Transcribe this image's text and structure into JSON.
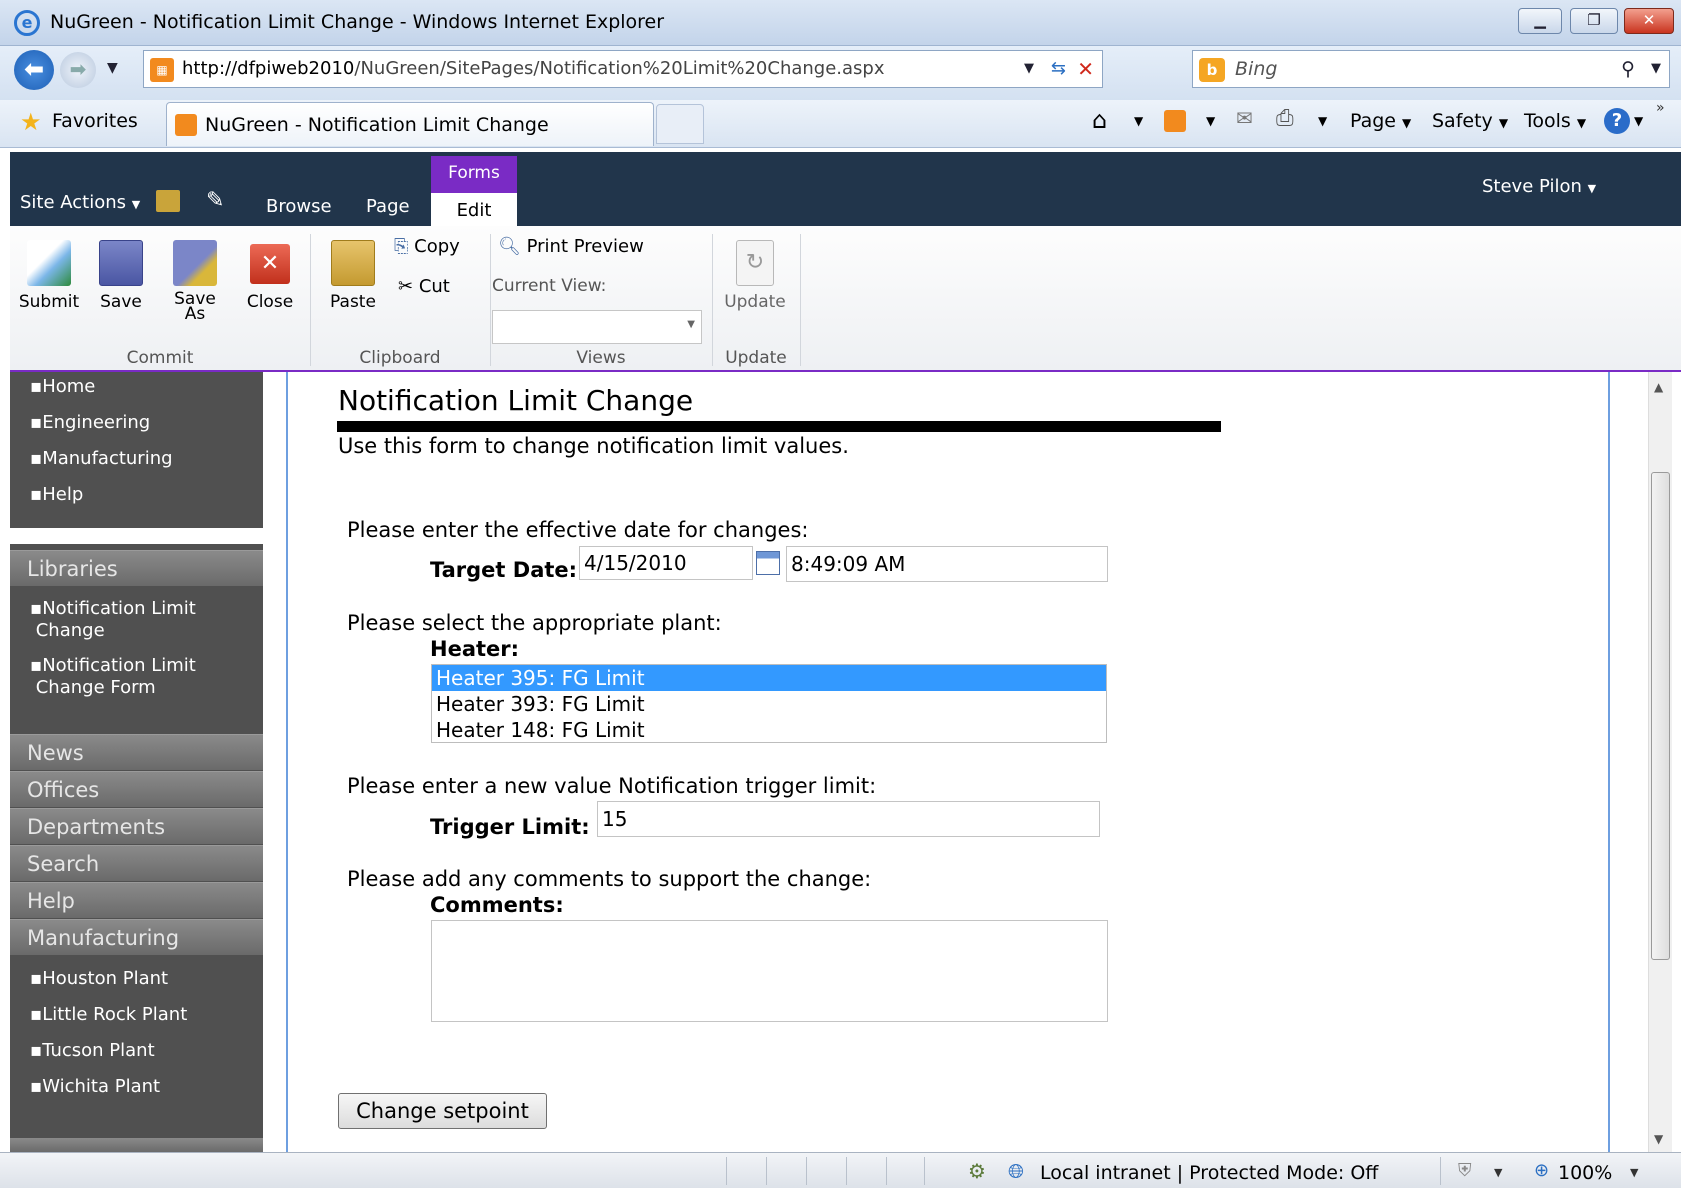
{
  "browser": {
    "window_title": "NuGreen - Notification Limit Change - Windows Internet Explorer",
    "url_host": "http://dfpiweb2010",
    "url_path": "/NuGreen/SitePages/Notification%20Limit%20Change.aspx",
    "search_placeholder": "Bing",
    "favorites_label": "Favorites",
    "tab_label": "NuGreen - Notification Limit Change",
    "menu": {
      "page": "Page",
      "safety": "Safety",
      "tools": "Tools"
    }
  },
  "sharepoint": {
    "site_actions": "Site Actions",
    "tabs": {
      "browse": "Browse",
      "page": "Page",
      "edit": "Edit"
    },
    "context_tab": "Forms",
    "user": "Steve Pilon",
    "ribbon": {
      "submit": "Submit",
      "save": "Save",
      "save_as_1": "Save",
      "save_as_2": "As",
      "close": "Close",
      "paste": "Paste",
      "copy": "Copy",
      "cut": "Cut",
      "print_preview": "Print Preview",
      "current_view": "Current View:",
      "update": "Update",
      "groups": {
        "commit": "Commit",
        "clipboard": "Clipboard",
        "views": "Views",
        "update": "Update"
      }
    }
  },
  "leftnav": {
    "top_links": [
      "Home",
      "Engineering",
      "Manufacturing",
      "Help"
    ],
    "libraries_heading": "Libraries",
    "library_links": [
      {
        "line1": "Notification Limit",
        "line2": "Change"
      },
      {
        "line1": "Notification Limit",
        "line2": "Change Form"
      }
    ],
    "headings": [
      "News",
      "Offices",
      "Departments",
      "Search",
      "Help",
      "Manufacturing"
    ],
    "plant_links": [
      "Houston Plant",
      "Little Rock Plant",
      "Tucson Plant",
      "Wichita Plant"
    ]
  },
  "form": {
    "title": "Notification Limit Change",
    "description": "Use this form to change notification limit values.",
    "date_prompt": "Please enter the effective date for changes:",
    "target_date_label": "Target Date:",
    "target_date_value": "4/15/2010",
    "target_time_value": "8:49:09 AM",
    "plant_prompt": "Please select the appropriate plant:",
    "heater_label": "Heater:",
    "heater_options": [
      "Heater 395: FG Limit",
      "Heater 393: FG Limit",
      "Heater 148: FG Limit"
    ],
    "heater_selected": "Heater 395: FG Limit",
    "trigger_prompt": "Please enter a new value Notification trigger limit:",
    "trigger_label": "Trigger Limit:",
    "trigger_value": "15",
    "comments_prompt": "Please add any comments to support the change:",
    "comments_label": "Comments:",
    "comments_value": "",
    "submit_button": "Change setpoint"
  },
  "status": {
    "zone": "Local intranet | Protected Mode: Off",
    "zoom": "100%"
  }
}
